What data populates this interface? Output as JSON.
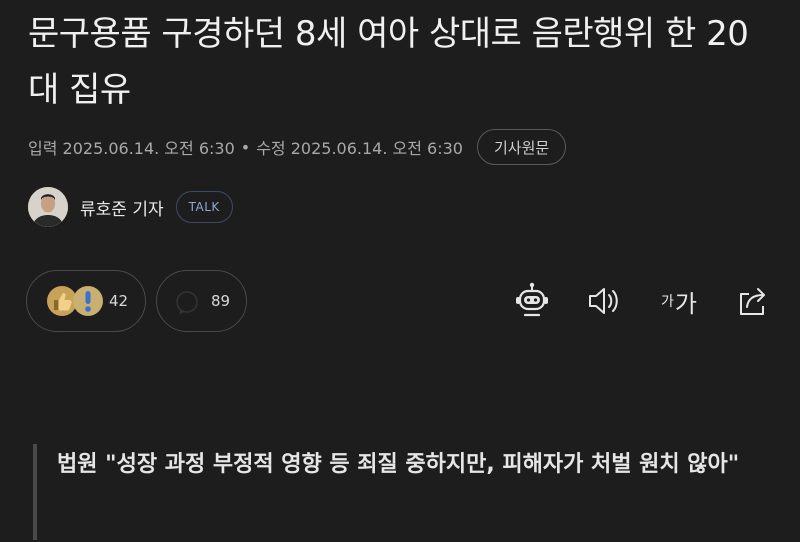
{
  "article": {
    "title": "문구용품 구경하던 8세 여아 상대로 음란행위 한 20대 집유",
    "meta": {
      "published": "입력 2025.06.14. 오전 6:30",
      "separator": "•",
      "modified": "수정 2025.06.14. 오전 6:30",
      "original_button": "기사원문"
    },
    "reporter": {
      "name": "류호준 기자",
      "talk_label": "TALK"
    },
    "reactions": {
      "like_count": "42",
      "comment_count": "89"
    },
    "tools": {
      "font_size_small": "가",
      "font_size_large": "가"
    },
    "subheadline": "법원 \"성장 과정 부정적 영향 등 죄질 중하지만, 피해자가 처벌 원치 않아\""
  }
}
